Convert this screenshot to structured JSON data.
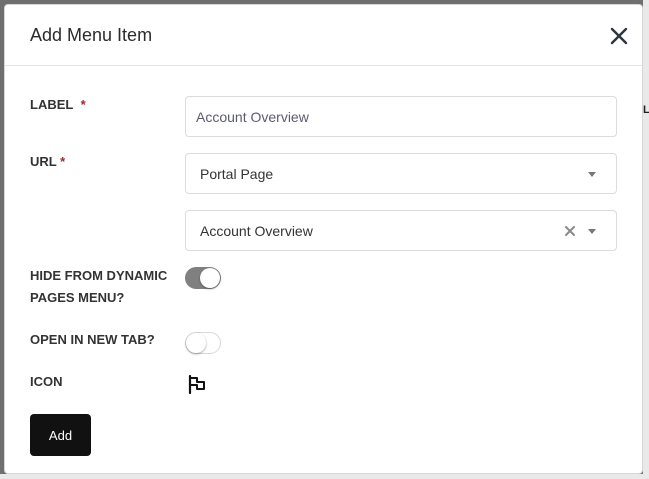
{
  "modal": {
    "title": "Add Menu Item",
    "close_icon": "close-icon"
  },
  "form": {
    "label_field": {
      "label": "LABEL",
      "required_mark": "*",
      "value": "Account Overview"
    },
    "url_field": {
      "label": "URL",
      "required_mark": "*",
      "type_select": {
        "value": "Portal Page",
        "icon": "chevron-down-icon"
      },
      "page_select": {
        "value": "Account Overview",
        "clear_icon": "clear-icon",
        "icon": "chevron-down-icon"
      }
    },
    "hide_toggle": {
      "label_line1": "HIDE FROM DYNAMIC",
      "label_line2": "PAGES MENU?",
      "checked": true
    },
    "new_tab_toggle": {
      "label": "OPEN IN NEW TAB?",
      "checked": false
    },
    "icon_field": {
      "label": "ICON",
      "icon": "flag-icon"
    },
    "submit_label": "Add"
  },
  "background": {
    "partial_text": "LABEL"
  },
  "colors": {
    "primary_button": "#111111",
    "toggle_on": "#808080",
    "required": "#a4262c",
    "overlay": "#6f6f6f"
  }
}
